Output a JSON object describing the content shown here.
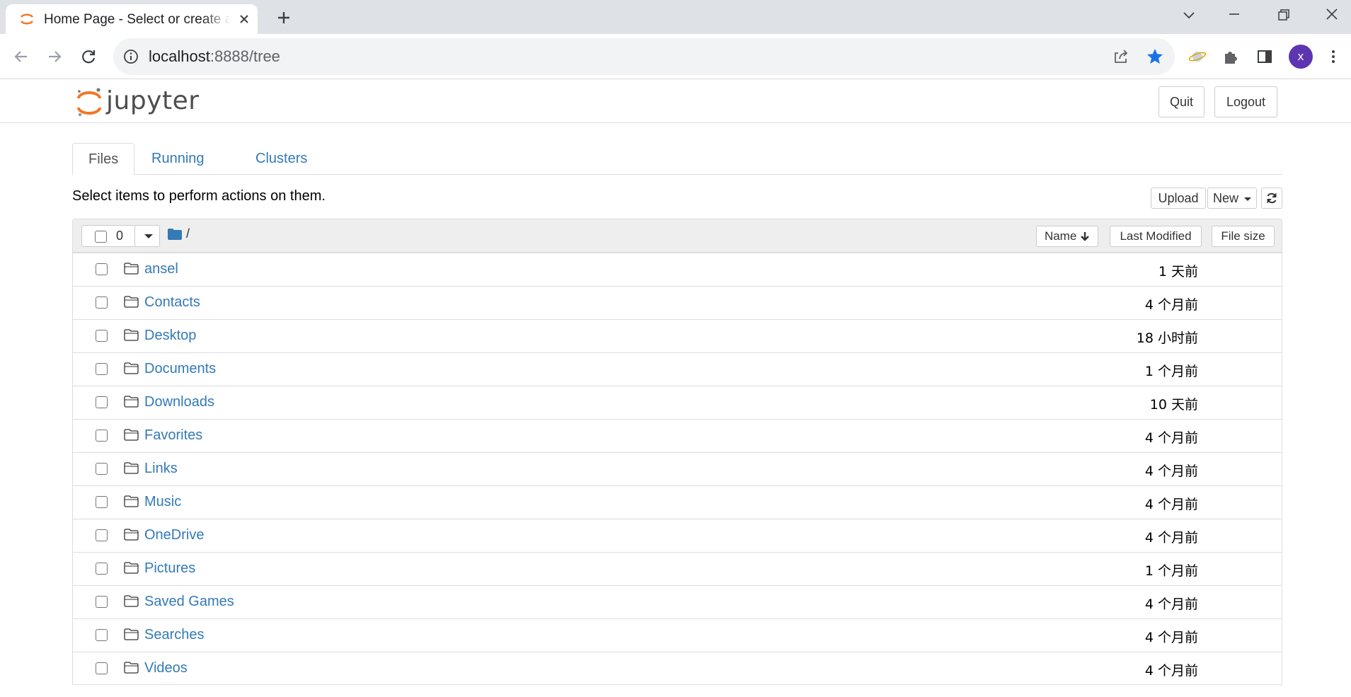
{
  "browser": {
    "tab_title": "Home Page - Select or create a notebook",
    "url_host": "localhost",
    "url_path": ":8888/tree",
    "avatar_letter": "x"
  },
  "header": {
    "logo_text": "jupyter",
    "quit_label": "Quit",
    "logout_label": "Logout"
  },
  "tabs": [
    {
      "label": "Files"
    },
    {
      "label": "Running"
    },
    {
      "label": "Clusters"
    }
  ],
  "toolbar": {
    "hint": "Select items to perform actions on them.",
    "upload_label": "Upload",
    "new_label": "New"
  },
  "list_header": {
    "selected_count": "0",
    "breadcrumb": "/",
    "name_label": "Name",
    "last_modified_label": "Last Modified",
    "file_size_label": "File size"
  },
  "files": [
    {
      "name": "ansel",
      "modified": "1 天前"
    },
    {
      "name": "Contacts",
      "modified": "4 个月前"
    },
    {
      "name": "Desktop",
      "modified": "18 小时前"
    },
    {
      "name": "Documents",
      "modified": "1 个月前"
    },
    {
      "name": "Downloads",
      "modified": "10 天前"
    },
    {
      "name": "Favorites",
      "modified": "4 个月前"
    },
    {
      "name": "Links",
      "modified": "4 个月前"
    },
    {
      "name": "Music",
      "modified": "4 个月前"
    },
    {
      "name": "OneDrive",
      "modified": "4 个月前"
    },
    {
      "name": "Pictures",
      "modified": "1 个月前"
    },
    {
      "name": "Saved Games",
      "modified": "4 个月前"
    },
    {
      "name": "Searches",
      "modified": "4 个月前"
    },
    {
      "name": "Videos",
      "modified": "4 个月前"
    }
  ],
  "colors": {
    "link": "#337ab7",
    "jupyter_orange": "#f37626",
    "bookmark_star": "#1a73e8",
    "avatar": "#5e35b1"
  }
}
